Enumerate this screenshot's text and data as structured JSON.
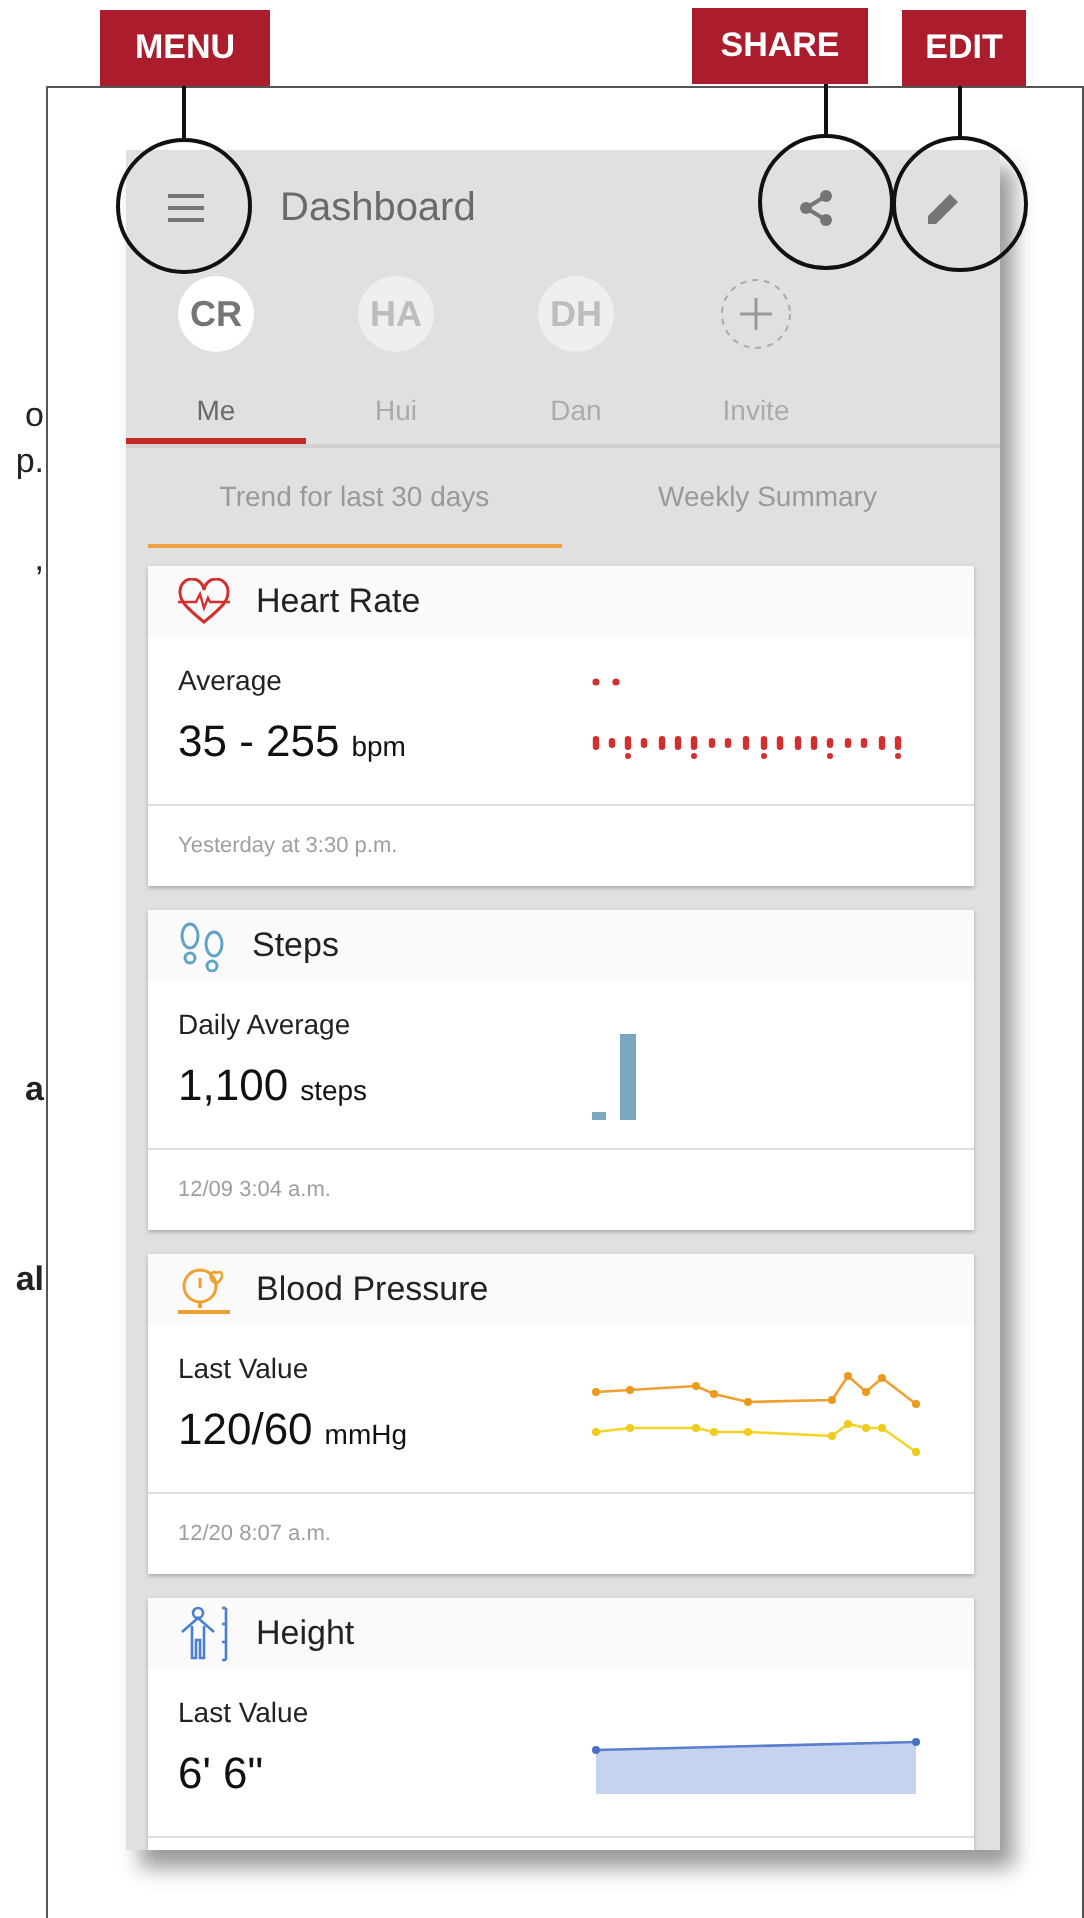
{
  "margin_fragments": [
    {
      "text": "o",
      "bold": false
    },
    {
      "text": "p.",
      "bold": false
    },
    {
      "text": ",",
      "bold": false
    },
    {
      "text": "a",
      "bold": true
    },
    {
      "text": "al",
      "bold": true
    }
  ],
  "callouts": [
    {
      "label": "MENU"
    },
    {
      "label": "SHARE"
    },
    {
      "label": "EDIT"
    }
  ],
  "app_bar": {
    "title": "Dashboard"
  },
  "people": [
    {
      "kind": "person",
      "initials": "CR",
      "name": "Me",
      "selected": true
    },
    {
      "kind": "person",
      "initials": "HA",
      "name": "Hui",
      "selected": false
    },
    {
      "kind": "person",
      "initials": "DH",
      "name": "Dan",
      "selected": false
    },
    {
      "kind": "invite",
      "name": "Invite",
      "selected": false
    }
  ],
  "view_tabs": [
    {
      "label": "Trend for last 30 days",
      "selected": true
    },
    {
      "label": "Weekly Summary",
      "selected": false
    }
  ],
  "cards": [
    {
      "kind": "heart_rate",
      "title": "Heart Rate",
      "label": "Average",
      "value": "35 - 255",
      "unit": "bpm",
      "timestamp": "Yesterday at 3:30 p.m."
    },
    {
      "kind": "steps",
      "title": "Steps",
      "label": "Daily Average",
      "value": "1,100",
      "unit": "steps",
      "timestamp": "12/09 3:04 a.m."
    },
    {
      "kind": "blood_pressure",
      "title": "Blood Pressure",
      "label": "Last Value",
      "value": "120/60",
      "unit": "mmHg",
      "timestamp": "12/20 8:07 a.m."
    },
    {
      "kind": "height",
      "title": "Height",
      "label": "Last Value",
      "value": "6' 6\""
    }
  ]
}
